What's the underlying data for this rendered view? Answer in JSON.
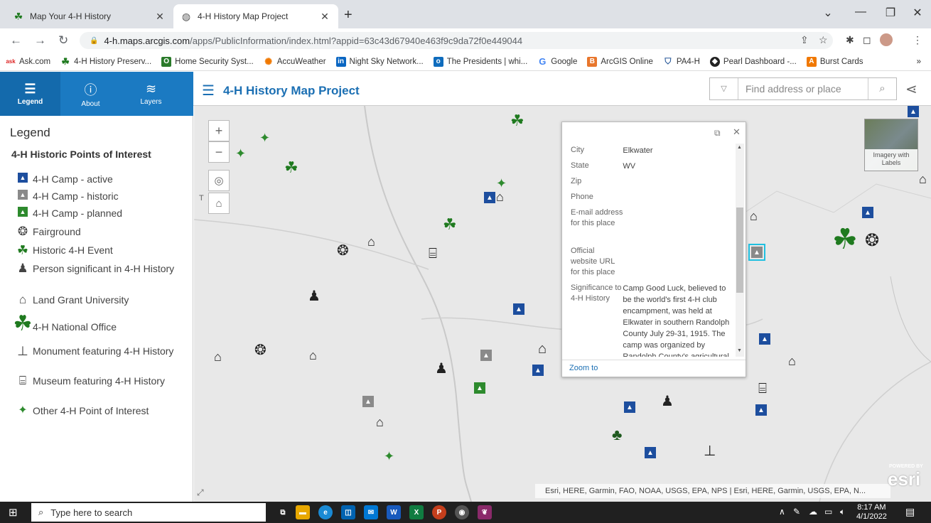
{
  "browser": {
    "tabs": [
      {
        "title": "Map Your 4-H History",
        "active": false
      },
      {
        "title": "4-H History Map Project",
        "active": true
      }
    ],
    "url_host": "4-h.maps.arcgis.com",
    "url_path": "/apps/PublicInformation/index.html?appid=63c43d67940e463f9c9da72f0e449044",
    "bookmarks": [
      "Ask.com",
      "4-H History Preserv...",
      "Home Security Syst...",
      "AccuWeather",
      "Night Sky Network...",
      "The Presidents | whi...",
      "Google",
      "ArcGIS Online",
      "PA4-H",
      "Pearl Dashboard -...",
      "Burst Cards"
    ],
    "more_bookmarks": "»"
  },
  "app": {
    "title": "4-H History Map Project",
    "side_tabs": [
      "Legend",
      "About",
      "Layers"
    ],
    "search_placeholder": "Find address or place"
  },
  "legend": {
    "heading": "Legend",
    "layer_title": "4-H Historic Points of Interest",
    "items": [
      "4-H Camp - active",
      "4-H Camp - historic",
      "4-H Camp - planned",
      "Fairground",
      "Historic 4-H Event",
      "Person significant in 4-H History",
      "Land Grant University",
      "4-H National Office",
      "Monument featuring 4-H History",
      "Museum featuring 4-H History",
      "Other 4-H Point of Interest"
    ]
  },
  "popup": {
    "rows": [
      {
        "k": "City",
        "v": "Elkwater"
      },
      {
        "k": "State",
        "v": "WV"
      },
      {
        "k": "Zip",
        "v": ""
      },
      {
        "k": "Phone",
        "v": ""
      },
      {
        "k": "E-mail address for this place",
        "v": ""
      },
      {
        "k": "Official website URL for this place",
        "v": ""
      },
      {
        "k": "Significance to 4-H History",
        "v": "Camp Good Luck, believed to be the world's first 4-H club encampment, was held at Elkwater in southern Randolph County July 29-31, 1915. The camp was organized by Randolph County's agricultural"
      }
    ],
    "zoom_link": "Zoom to"
  },
  "map": {
    "attribution": "Esri, HERE, Garmin, FAO, NOAA, USGS, EPA, NPS | Esri, HERE, Garmin, USGS, EPA, N...",
    "basemap_label": "Imagery with Labels",
    "powered_by": "POWERED BY",
    "esri": "esri",
    "side_letter": "T"
  },
  "taskbar": {
    "search_placeholder": "Type here to search",
    "time": "8:17 AM",
    "date": "4/1/2022"
  },
  "colors": {
    "accent": "#1b7ac2",
    "camp_active": "#1d4e9e",
    "camp_historic": "#8a8a8a",
    "camp_planned": "#2d8a2d",
    "clover": "#1f7a1f"
  }
}
